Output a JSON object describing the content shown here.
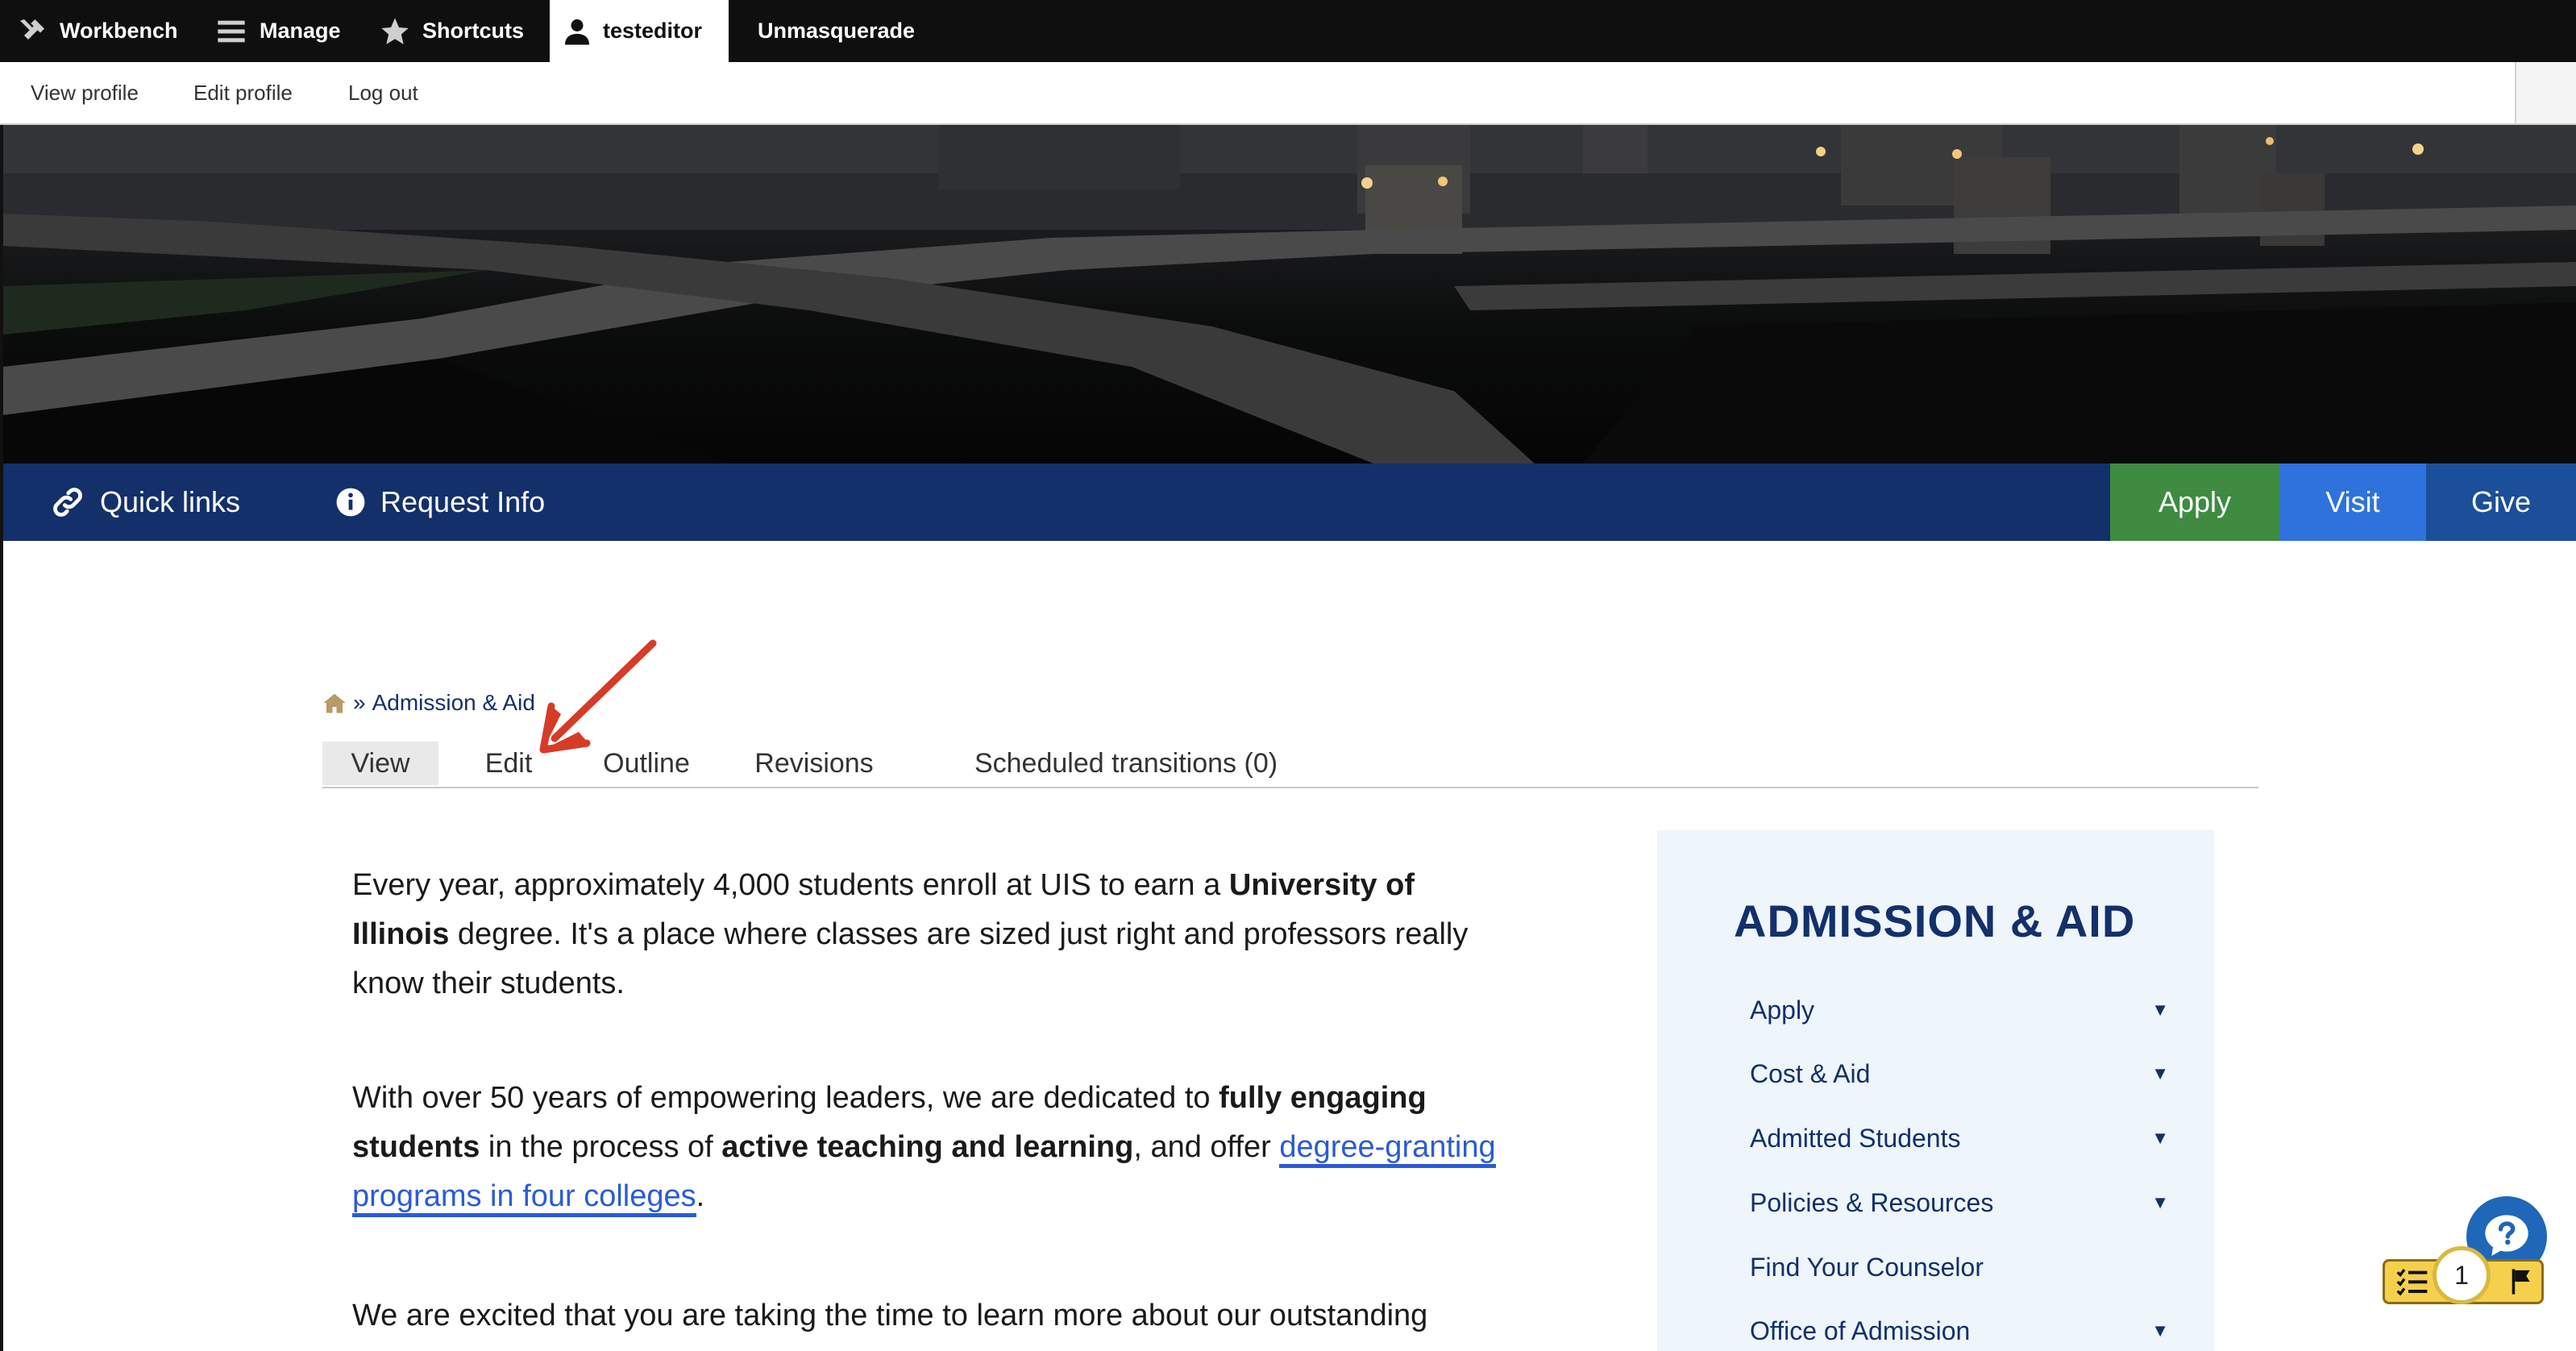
{
  "toolbar": {
    "workbench": "Workbench",
    "manage": "Manage",
    "shortcuts": "Shortcuts",
    "user": "testeditor",
    "unmasquerade": "Unmasquerade"
  },
  "user_tray": {
    "view_profile": "View profile",
    "edit_profile": "Edit profile",
    "log_out": "Log out"
  },
  "site_nav": {
    "quick_links": "Quick links",
    "request_info": "Request Info",
    "apply": "Apply",
    "visit": "Visit",
    "give": "Give"
  },
  "colors": {
    "toolbar_bg": "#0f0f0f",
    "nav_blue": "#13306a",
    "apply_green": "#3e8b41",
    "visit_blue": "#2f72dd",
    "give_blue": "#1b4f99",
    "link_blue": "#2a5bd7",
    "annotation_red": "#d63b25"
  },
  "breadcrumb": {
    "separator": "»",
    "current": "Admission & Aid"
  },
  "tabs": [
    {
      "label": "View"
    },
    {
      "label": "Edit"
    },
    {
      "label": "Outline"
    },
    {
      "label": "Revisions"
    },
    {
      "label": "Scheduled transitions (0)"
    }
  ],
  "body": {
    "p1": {
      "t1": "Every year, approximately 4,000 students enroll at UIS to earn a ",
      "b1": "University of Illinois",
      "t2": " degree. It's a place where classes are sized just right and professors really know their students."
    },
    "p2": {
      "t1": "With over 50 years of empowering leaders, we are dedicated to ",
      "b1": "fully engaging students",
      "t2": " in the process of ",
      "b2": "active teaching and learning",
      "t3": ", and offer ",
      "link": "degree-granting programs in four colleges",
      "t4": "."
    },
    "p3": {
      "t1": "We are excited that you are taking the time to learn more about our outstanding"
    }
  },
  "sidebar": {
    "title": "ADMISSION & AID",
    "items": [
      {
        "label": "Apply",
        "expandable": true
      },
      {
        "label": "Cost & Aid",
        "expandable": true
      },
      {
        "label": "Admitted Students",
        "expandable": true
      },
      {
        "label": "Policies & Resources",
        "expandable": true
      },
      {
        "label": "Find Your Counselor",
        "expandable": false
      },
      {
        "label": "Office of Admission",
        "expandable": true
      }
    ]
  },
  "widgets": {
    "issue_count": "1"
  },
  "icons": {
    "workbench": "tools-icon",
    "manage": "hamburger-icon",
    "shortcuts": "star-icon",
    "user": "person-icon",
    "quick_links": "link-icon",
    "request_info": "info-icon",
    "home": "home-icon",
    "chevron": "triangle-down-icon",
    "help": "question-bubble-icon",
    "checklist": "checklist-icon",
    "flag": "flag-icon"
  }
}
